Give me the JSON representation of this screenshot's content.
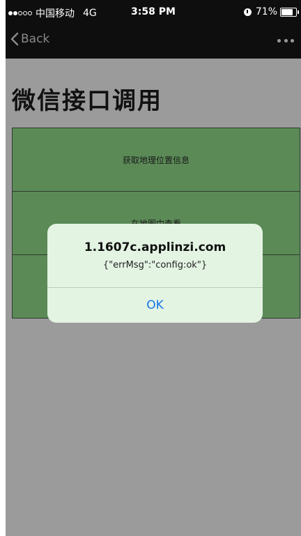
{
  "status_bar": {
    "carrier": "中国移动",
    "network": "4G",
    "time": "3:58 PM",
    "battery": "71%",
    "battery_level": 0.71,
    "signal_bars_filled": 2,
    "signal_bars_total": 5
  },
  "nav": {
    "back_label": "Back",
    "more_icon": "more-icon"
  },
  "page": {
    "title": "微信接口调用",
    "buttons": [
      {
        "label": "获取地理位置信息"
      },
      {
        "label": "在地图中查看"
      },
      {
        "label": ""
      }
    ]
  },
  "alert": {
    "title": "1.1607c.applinzi.com",
    "message": "{\"errMsg\":\"config:ok\"}",
    "ok_label": "OK"
  },
  "colors": {
    "bar_bg": "#0e0e0e",
    "overlay_bg": "#9b9b9b",
    "button_green": "#5b8a57",
    "alert_bg": "#e3f4e3",
    "ok_blue": "#1673e6"
  }
}
